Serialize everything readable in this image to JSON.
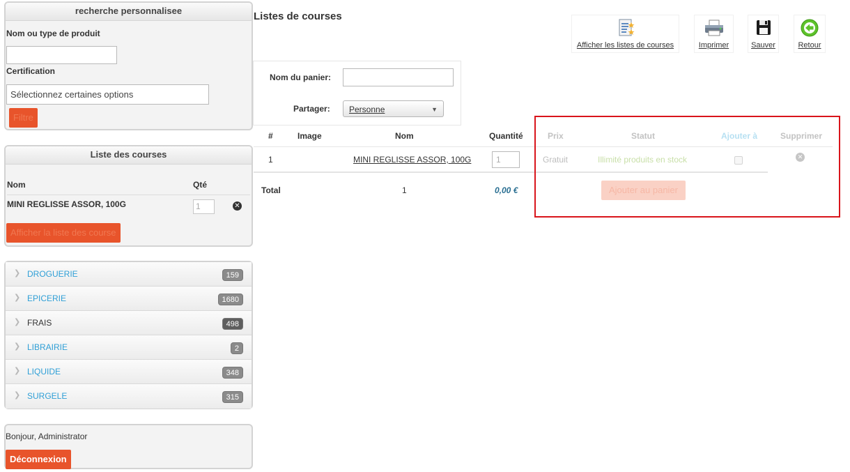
{
  "search_panel": {
    "title": "recherche personnalisee",
    "product_label": "Nom ou type de produit",
    "product_value": "",
    "certification_label": "Certification",
    "certification_placeholder": "Sélectionnez certaines options",
    "filter_button": "Filtre"
  },
  "list_panel": {
    "title": "Liste des courses",
    "col_name": "Nom",
    "col_qty": "Qté",
    "items": [
      {
        "name": "MINI REGLISSE ASSOR, 100G",
        "qty": "1"
      }
    ],
    "show_list_button": "Afficher la liste des course"
  },
  "categories": [
    {
      "label": "DROGUERIE",
      "count": "159"
    },
    {
      "label": "EPICERIE",
      "count": "1680"
    },
    {
      "label": "FRAIS",
      "count": "498"
    },
    {
      "label": "LIBRAIRIE",
      "count": "2"
    },
    {
      "label": "LIQUIDE",
      "count": "348"
    },
    {
      "label": "SURGELE",
      "count": "315"
    }
  ],
  "user_panel": {
    "greeting": "Bonjour, Administrator",
    "logout_button": "Déconnexion"
  },
  "main": {
    "page_title": "Listes de courses",
    "toolbar": {
      "show_lists": "Afficher les listes de courses",
      "print": "Imprimer",
      "save": "Sauver",
      "back": "Retour"
    },
    "basket_form": {
      "name_label": "Nom du panier:",
      "name_value": "",
      "share_label": "Partager:",
      "share_selected": "Personne"
    },
    "table": {
      "headers": [
        "#",
        "Image",
        "Nom",
        "Quantité",
        "Prix",
        "Statut",
        "Ajouter à",
        "Supprimer"
      ],
      "rows": [
        {
          "index": "1",
          "name": "MINI REGLISSE ASSOR, 100G",
          "qty": "1",
          "price": "Gratuit",
          "status": "Illimité produits en stock"
        }
      ],
      "total_label": "Total",
      "total_count": "1",
      "total_amount": "0,00 €",
      "add_to_button": "Ajouter au panier"
    }
  },
  "colors": {
    "accent": "#e8542b",
    "link_blue": "#2f9fd6",
    "highlight_border": "#d9141b",
    "status_green": "#c8dfa8"
  }
}
